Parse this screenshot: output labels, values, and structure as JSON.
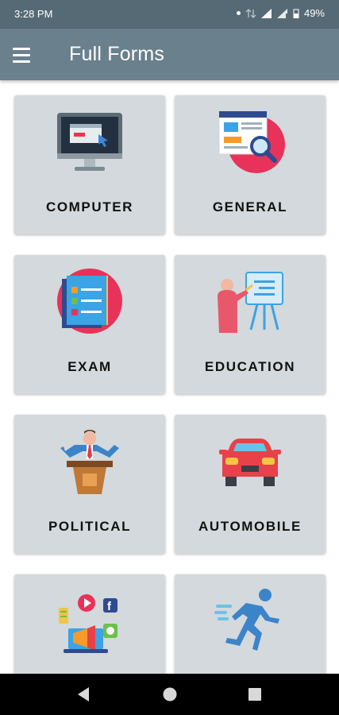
{
  "status_bar": {
    "time": "3:28 PM",
    "battery": "49%"
  },
  "app_bar": {
    "title": "Full Forms"
  },
  "categories": [
    {
      "label": "COMPUTER",
      "icon": "computer-monitor-icon"
    },
    {
      "label": "GENERAL",
      "icon": "web-search-icon"
    },
    {
      "label": "EXAM",
      "icon": "exam-documents-icon"
    },
    {
      "label": "EDUCATION",
      "icon": "teacher-board-icon"
    },
    {
      "label": "POLITICAL",
      "icon": "politician-podium-icon"
    },
    {
      "label": "AUTOMOBILE",
      "icon": "car-icon"
    },
    {
      "label": "",
      "icon": "social-media-marketing-icon"
    },
    {
      "label": "",
      "icon": "running-man-icon"
    }
  ],
  "colors": {
    "status_bar": "#556a75",
    "app_bar": "#6a808c",
    "card": "#d3d9dc"
  }
}
